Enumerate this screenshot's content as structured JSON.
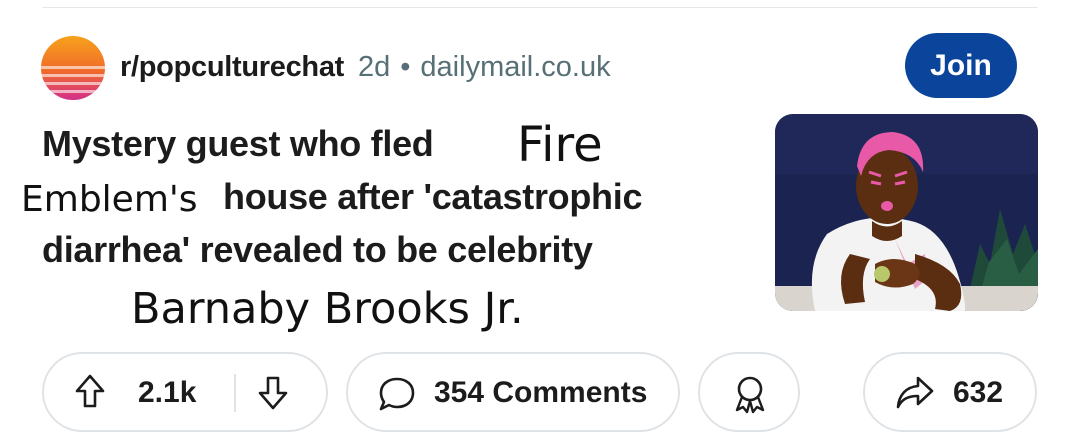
{
  "post": {
    "subreddit": "r/popculturechat",
    "age": "2d",
    "separator": "•",
    "domain": "dailymail.co.uk",
    "join_label": "Join",
    "title": {
      "line1": "Mystery guest who fled",
      "line1_edit": "Fire",
      "line2_edit": "Emblem's",
      "line2": "house after 'catastrophic",
      "line3": "diarrhea' revealed to be celebrity",
      "line4_edit": "Barnaby Brooks Jr."
    }
  },
  "actions": {
    "score": "2.1k",
    "comments": "354 Comments",
    "shares": "632"
  },
  "icons": [
    "subreddit-avatar-icon",
    "upvote-arrow-icon",
    "downvote-arrow-icon",
    "comment-bubble-icon",
    "award-icon",
    "share-arrow-icon"
  ],
  "colors": {
    "join_button": "#0a449b",
    "meta_text": "#576f76",
    "pill_border": "#dfe3e6",
    "thumbnail_bg": "#1b2350",
    "hair_pink": "#e85aa8"
  }
}
